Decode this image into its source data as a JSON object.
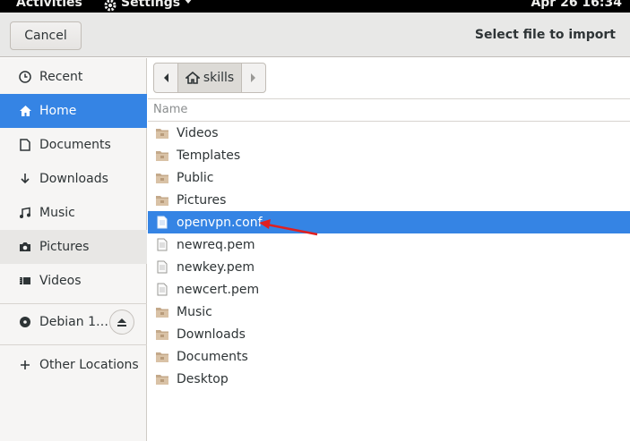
{
  "topbar": {
    "activities": "Activities",
    "app_menu": "Settings",
    "clock": "Apr 26  16:34"
  },
  "header": {
    "cancel_label": "Cancel",
    "title": "Select file to import"
  },
  "sidebar": {
    "items": [
      {
        "label": "Recent",
        "icon": "clock-icon"
      },
      {
        "label": "Home",
        "icon": "home-icon",
        "selected": true
      },
      {
        "label": "Documents",
        "icon": "document-icon"
      },
      {
        "label": "Downloads",
        "icon": "download-icon"
      },
      {
        "label": "Music",
        "icon": "music-icon"
      },
      {
        "label": "Pictures",
        "icon": "camera-icon"
      },
      {
        "label": "Videos",
        "icon": "video-icon"
      }
    ],
    "devices": [
      {
        "label": "Debian 1…",
        "icon": "disc-icon"
      }
    ],
    "other_locations": "Other Locations"
  },
  "pathbar": {
    "current": "skills"
  },
  "file_list": {
    "column_name": "Name",
    "rows": [
      {
        "name": "Videos",
        "type": "folder"
      },
      {
        "name": "Templates",
        "type": "folder"
      },
      {
        "name": "Public",
        "type": "folder"
      },
      {
        "name": "Pictures",
        "type": "folder"
      },
      {
        "name": "openvpn.conf",
        "type": "file",
        "selected": true
      },
      {
        "name": "newreq.pem",
        "type": "file"
      },
      {
        "name": "newkey.pem",
        "type": "file"
      },
      {
        "name": "newcert.pem",
        "type": "file"
      },
      {
        "name": "Music",
        "type": "folder"
      },
      {
        "name": "Downloads",
        "type": "folder"
      },
      {
        "name": "Documents",
        "type": "folder"
      },
      {
        "name": "Desktop",
        "type": "folder"
      }
    ]
  },
  "colors": {
    "accent": "#3584e4",
    "annotation_arrow": "#e02020"
  }
}
